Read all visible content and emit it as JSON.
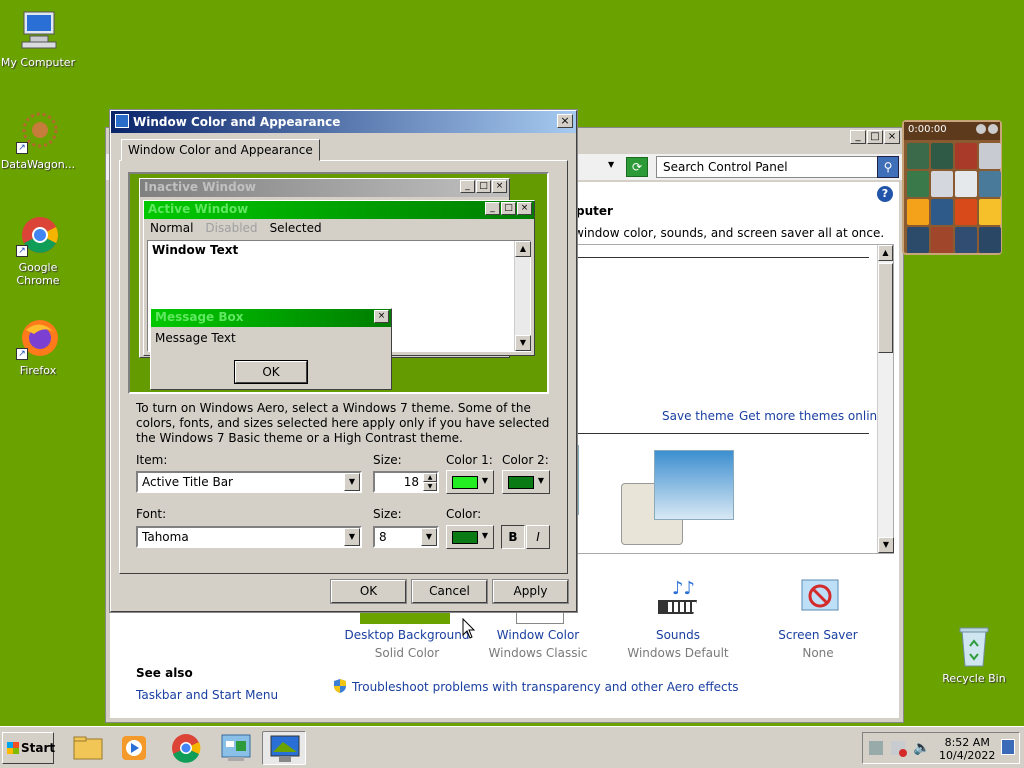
{
  "desktop": {
    "icons": [
      {
        "label": "My Computer"
      },
      {
        "label": "DataWagon..."
      },
      {
        "label": "Google Chrome"
      },
      {
        "label": "Firefox"
      },
      {
        "label": "Recycle Bin"
      }
    ]
  },
  "control_panel": {
    "search_placeholder": "Search Control Panel",
    "heading_fragment": "puter",
    "subtext_fragment": "window color, sounds, and screen saver all at once.",
    "save_theme": "Save theme",
    "get_more_themes": "Get more themes online",
    "bottom_items": [
      {
        "label": "Desktop Background",
        "sub": "Solid Color"
      },
      {
        "label": "Window Color",
        "sub": "Windows Classic"
      },
      {
        "label": "Sounds",
        "sub": "Windows Default"
      },
      {
        "label": "Screen Saver",
        "sub": "None"
      }
    ],
    "see_also": "See also",
    "taskbar_link": "Taskbar and Start Menu",
    "troubleshoot_link": "Troubleshoot problems with transparency and other Aero effects"
  },
  "gadget": {
    "timer": "0:00:00"
  },
  "dialog": {
    "title": "Window Color and Appearance",
    "tab": "Window Color and Appearance",
    "preview": {
      "inactive_title": "Inactive Window",
      "active_title": "Active Window",
      "menu": [
        "Normal",
        "Disabled",
        "Selected"
      ],
      "window_text": "Window Text",
      "msgbox_title": "Message Box",
      "msgbox_text": "Message Text",
      "msgbox_ok": "OK"
    },
    "description": "To turn on Windows Aero, select a Windows 7 theme.  Some of the colors, fonts, and sizes selected here apply only if you have selected the Windows 7 Basic theme or a High Contrast theme.",
    "item_label": "Item:",
    "item_value": "Active Title Bar",
    "item_size_label": "Size:",
    "item_size_value": "18",
    "color1_label": "Color 1:",
    "color2_label": "Color 2:",
    "color1": "#22ee22",
    "color2": "#0a7a14",
    "font_label": "Font:",
    "font_value": "Tahoma",
    "font_size_label": "Size:",
    "font_size_value": "8",
    "font_color_label": "Color:",
    "font_color": "#0a7a14",
    "bold": "B",
    "italic": "I",
    "ok": "OK",
    "cancel": "Cancel",
    "apply": "Apply"
  },
  "taskbar": {
    "start": "Start",
    "time": "8:52 AM",
    "date": "10/4/2022"
  },
  "colors": {
    "desktop": "#6aa200",
    "active_title_start": "#00c800",
    "active_title_end": "#007d00"
  }
}
